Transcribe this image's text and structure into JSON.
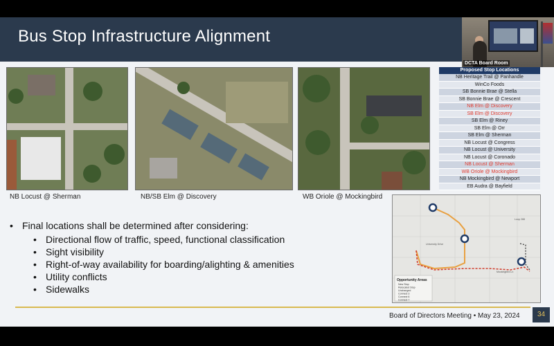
{
  "slide": {
    "title": "Bus Stop Infrastructure Alignment",
    "webcam_label": "DCTA Board Room",
    "captions": [
      "NB Locust @ Sherman",
      "NB/SB Elm @ Discovery",
      "WB Oriole @ Mockingbird"
    ],
    "stop_table": {
      "header": "Proposed Stop Locations",
      "rows": [
        {
          "name": "NB Heritage Trail @ Panhandle",
          "highlight": false
        },
        {
          "name": "WinCo Foods",
          "highlight": false
        },
        {
          "name": "SB Bonnie Brae @ Stella",
          "highlight": false
        },
        {
          "name": "SB Bonnie Brae @ Crescent",
          "highlight": false
        },
        {
          "name": "NB Elm @ Discovery",
          "highlight": true
        },
        {
          "name": "SB Elm @ Discovery",
          "highlight": true
        },
        {
          "name": "SB Elm @ Riney",
          "highlight": false
        },
        {
          "name": "SB Elm @ Orr",
          "highlight": false
        },
        {
          "name": "SB Elm @ Sherman",
          "highlight": false
        },
        {
          "name": "NB Locust @ Congress",
          "highlight": false
        },
        {
          "name": "NB Locust @ University",
          "highlight": false
        },
        {
          "name": "NB Locust @ Coronado",
          "highlight": false
        },
        {
          "name": "NB Locust @ Sherman",
          "highlight": true
        },
        {
          "name": "WB Oriole @ Mockingbird",
          "highlight": true
        },
        {
          "name": "NB Mockingbird @ Newport",
          "highlight": false
        },
        {
          "name": "EB Audra @ Bayfield",
          "highlight": false
        }
      ],
      "highlight_color": "#e23b2e"
    },
    "bullets": {
      "main": "Final locations shall be determined after considering:",
      "sub": [
        "Directional flow of traffic, speed, functional classification",
        "Sight visibility",
        "Right-of-way availability for boarding/alighting & amenities",
        "Utility conflicts",
        "Sidewalks"
      ]
    },
    "map": {
      "legend_title": "Opportunity Areas",
      "legend_items": [
        "New Stop",
        "Relocated Stop",
        "Unchanged",
        "Connect 3",
        "Connect 6",
        "Connect 7"
      ],
      "street_labels": [
        "University Drive",
        "Loop 288",
        "Mockingbird Ln"
      ]
    },
    "footer": "Board of Directors Meeting • May 23, 2024",
    "page_number": "34",
    "colors": {
      "title_bar": "#2b3a4d",
      "footer_rule": "#d9b94f",
      "table_header": "#1f3a66"
    }
  }
}
